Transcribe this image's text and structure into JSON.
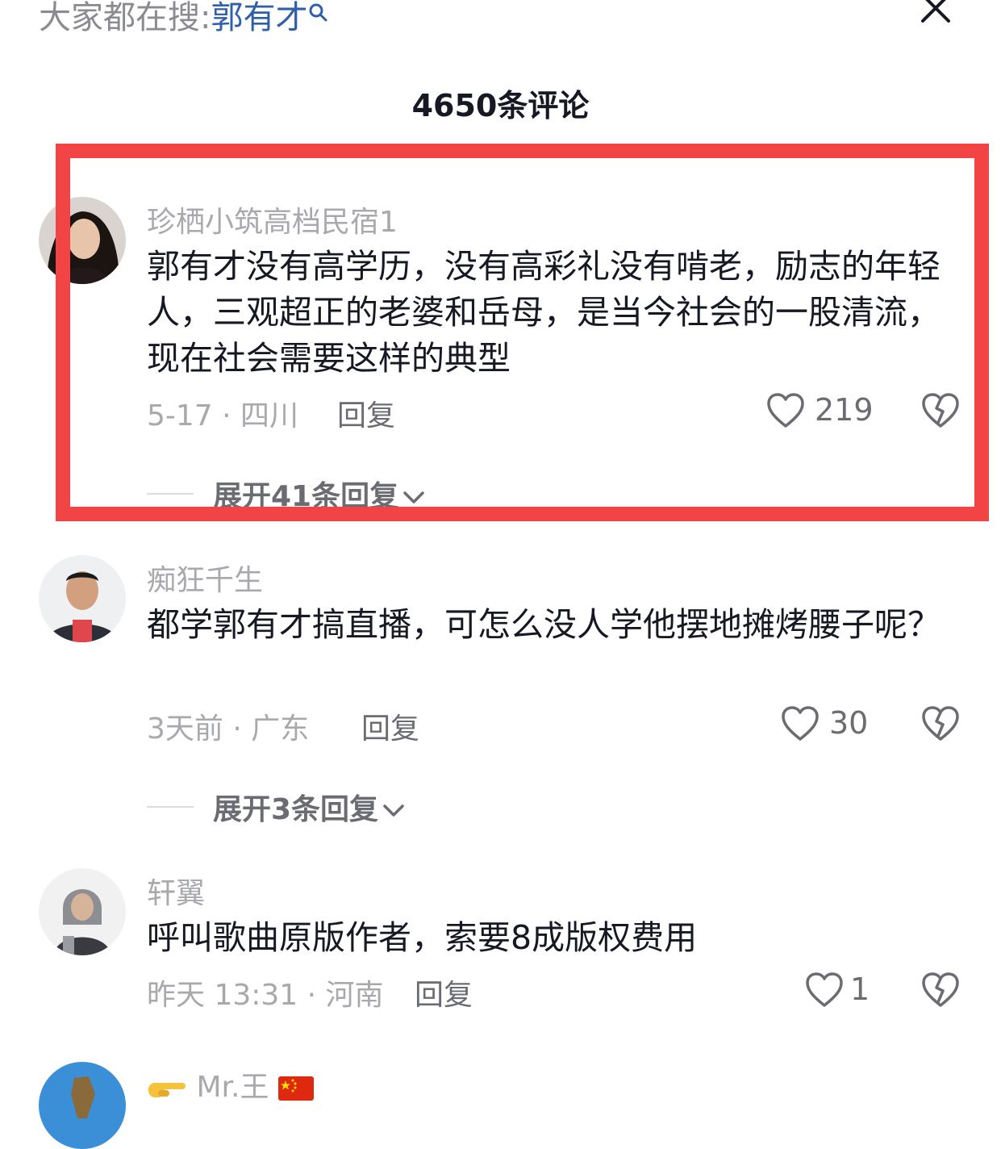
{
  "search_bar": {
    "prefix": "大家都在搜:",
    "keyword": "郭有才"
  },
  "comments_header": {
    "count_label": "4650条评论"
  },
  "comments": [
    {
      "username": "珍栖小筑高档民宿1",
      "text": "郭有才没有高学历，没有高彩礼没有啃老，励志的年轻人，三观超正的老婆和岳母，是当今社会的一股清流，现在社会需要这样的典型",
      "meta": "5-17 · 四川",
      "reply_label": "回复",
      "likes": "219",
      "expand_label": "展开41条回复"
    },
    {
      "username": "痴狂千生",
      "text": "都学郭有才搞直播，可怎么没人学他摆地摊烤腰子呢？",
      "meta": "3天前 · 广东",
      "reply_label": "回复",
      "likes": "30",
      "expand_label": "展开3条回复"
    },
    {
      "username": "轩翼",
      "text": "呼叫歌曲原版作者，索要8成版权费用",
      "meta": "昨天 13:31 · 河南",
      "reply_label": "回复",
      "likes": "1"
    },
    {
      "username": "Mr.王"
    }
  ],
  "colors": {
    "highlight_border": "#f24444",
    "keyword": "#2f5fa8",
    "muted": "#a8a9ad"
  }
}
